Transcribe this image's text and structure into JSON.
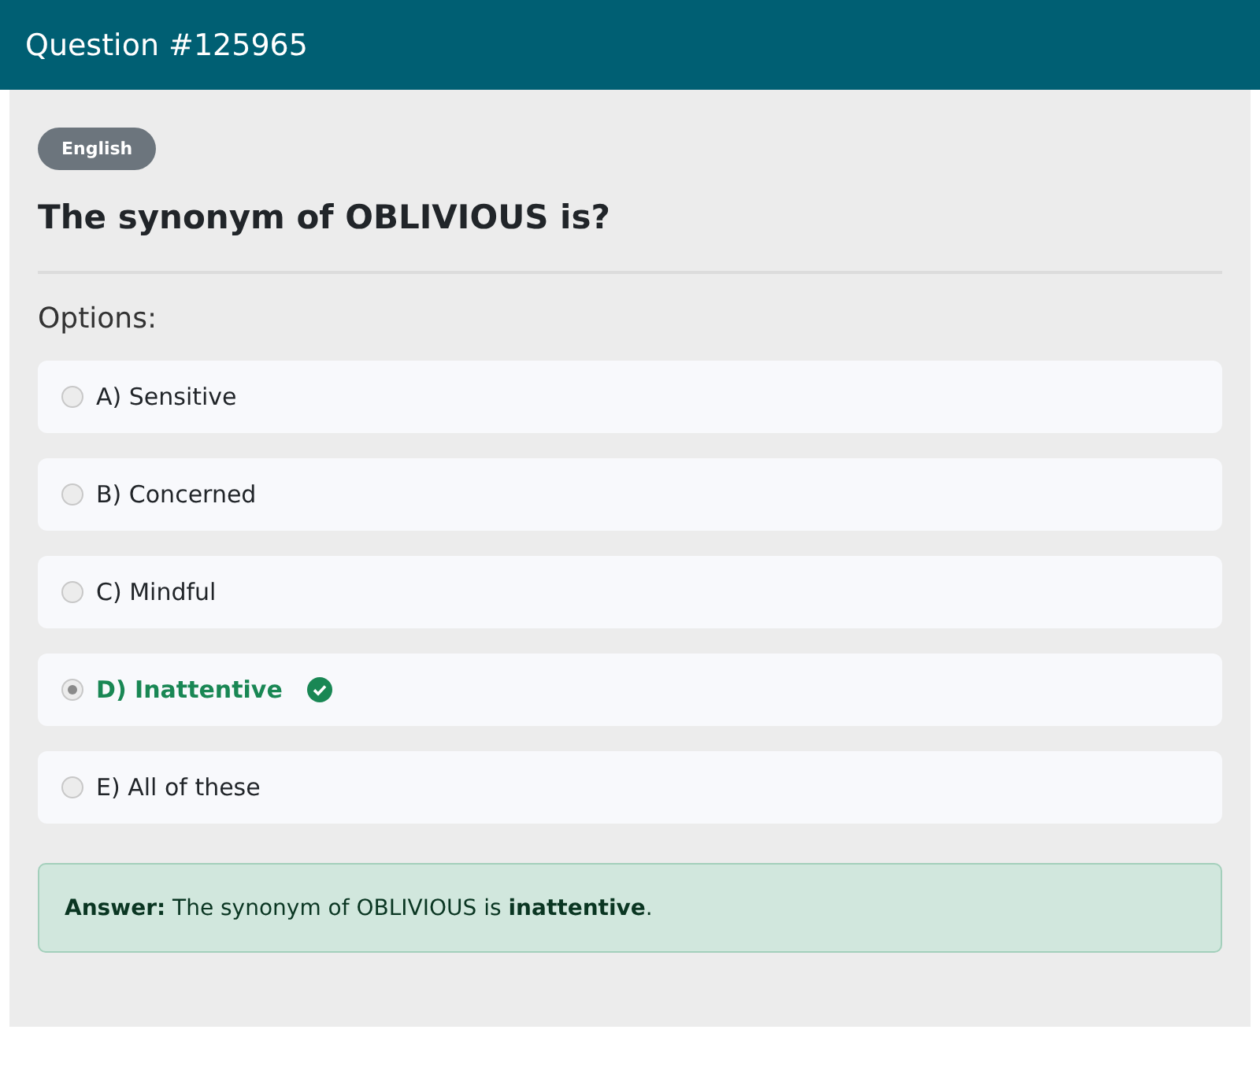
{
  "header": {
    "title": "Question #125965"
  },
  "category": "English",
  "question": "The synonym of OBLIVIOUS is?",
  "options_label": "Options:",
  "options": [
    {
      "label": "A) Sensitive",
      "selected": false,
      "correct": false
    },
    {
      "label": "B) Concerned",
      "selected": false,
      "correct": false
    },
    {
      "label": "C) Mindful",
      "selected": false,
      "correct": false
    },
    {
      "label": "D) Inattentive",
      "selected": true,
      "correct": true
    },
    {
      "label": "E) All of these",
      "selected": false,
      "correct": false
    }
  ],
  "answer": "**Answer:** The synonym of OBLIVIOUS is **inattentive**."
}
